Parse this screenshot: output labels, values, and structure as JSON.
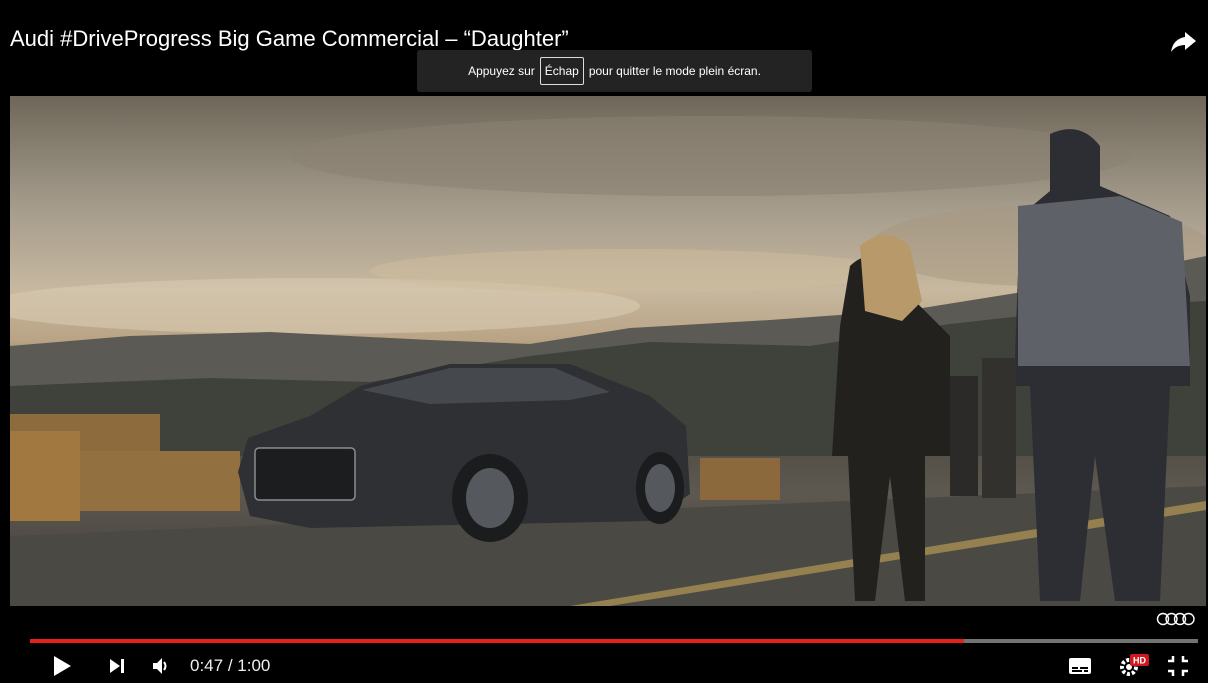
{
  "video": {
    "title": "Audi #DriveProgress Big Game Commercial – “Daughter”"
  },
  "toast": {
    "prefix": "Appuyez sur",
    "key": "Échap",
    "suffix": "pour quitter le mode plein écran."
  },
  "progress": {
    "current_time": "0:47",
    "separator": " / ",
    "duration": "1:00",
    "played_fraction": 0.8
  },
  "controls": {
    "time_display": "0:47 / 1:00",
    "icons": {
      "share": "share-arrow-icon",
      "play": "play-icon",
      "next": "skip-next-icon",
      "volume": "volume-icon",
      "subtitles": "subtitles-icon",
      "settings": "settings-gear-icon",
      "settings_badge": "HD",
      "exit_fullscreen": "exit-fullscreen-icon",
      "brand": "audi-rings-logo"
    }
  },
  "colors": {
    "progress_played": "#e62117",
    "badge": "#cc181e"
  }
}
